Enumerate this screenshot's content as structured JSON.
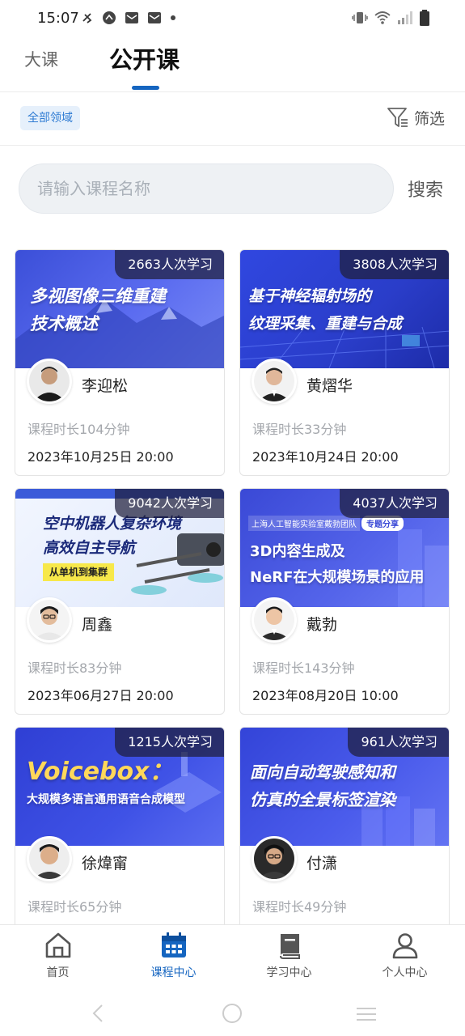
{
  "status_bar": {
    "time": "15:07"
  },
  "top_tabs": {
    "tab1": "大课",
    "tab2": "公开课"
  },
  "filter": {
    "domain_chip": "全部领域",
    "filter_label": "筛选"
  },
  "search": {
    "placeholder": "请输入课程名称",
    "button": "搜索"
  },
  "courses": [
    {
      "banner_line1": "多视图像三维重建",
      "banner_line2": "技术概述",
      "count": "2663人次学习",
      "teacher": "李迎松",
      "duration": "课程时长104分钟",
      "datetime": "2023年10月25日 20:00"
    },
    {
      "banner_line1": "基于神经辐射场的",
      "banner_line2": "纹理采集、重建与合成",
      "count": "3808人次学习",
      "teacher": "黄熠华",
      "duration": "课程时长33分钟",
      "datetime": "2023年10月24日 20:00"
    },
    {
      "banner_line1": "空中机器人复杂环境",
      "banner_line2": "高效自主导航",
      "banner_tag": "从单机到集群",
      "count": "9042人次学习",
      "teacher": "周鑫",
      "duration": "课程时长83分钟",
      "datetime": "2023年06月27日 20:00"
    },
    {
      "banner_top": "上海人工智能实验室戴勃团队",
      "banner_tag": "专题分享",
      "banner_line1": "3D内容生成及",
      "banner_line2": "NeRF在大规模场景的应用",
      "count": "4037人次学习",
      "teacher": "戴勃",
      "duration": "课程时长143分钟",
      "datetime": "2023年08月20日 10:00"
    },
    {
      "banner_line1": "Voicebox：",
      "banner_line2": "大规模多语言通用语音合成模型",
      "count": "1215人次学习",
      "teacher": "徐煒甯",
      "duration": "课程时长65分钟",
      "datetime": ""
    },
    {
      "banner_line1": "面向自动驾驶感知和",
      "banner_line2": "仿真的全景标签渲染",
      "count": "961人次学习",
      "teacher": "付潇",
      "duration": "课程时长49分钟",
      "datetime": ""
    }
  ],
  "bottom_nav": {
    "home": "首页",
    "courses": "课程中心",
    "study": "学习中心",
    "profile": "个人中心"
  },
  "colors": {
    "accent": "#1565c0",
    "chip_bg": "#e6f0fb"
  }
}
